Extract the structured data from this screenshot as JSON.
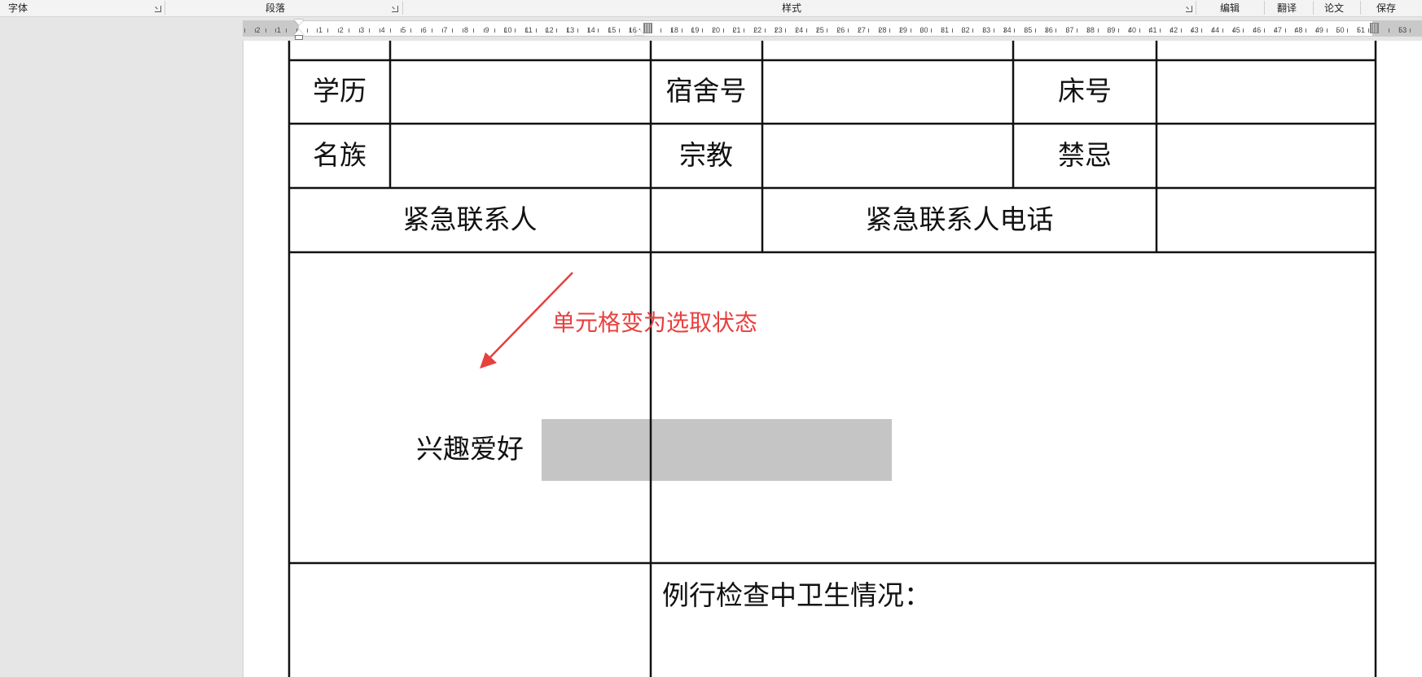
{
  "ribbon": {
    "groups": [
      "字体",
      "段落",
      "样式"
    ],
    "commands": [
      "编辑",
      "翻译",
      "论文",
      "保存"
    ]
  },
  "ruler": {
    "left_ticks": [
      "2",
      "1"
    ],
    "right_ticks": [
      "1",
      "2",
      "3",
      "4",
      "5",
      "6",
      "7",
      "8",
      "9",
      "10",
      "11",
      "12",
      "13",
      "14",
      "15",
      "16",
      "18",
      "19",
      "20",
      "21",
      "22",
      "23",
      "24",
      "25",
      "26",
      "27",
      "28",
      "29",
      "30",
      "31",
      "32",
      "33",
      "34",
      "35",
      "36",
      "37",
      "38",
      "39",
      "40",
      "41",
      "42",
      "43",
      "44",
      "45",
      "46",
      "47",
      "48",
      "49",
      "50",
      "51",
      "53"
    ]
  },
  "table": {
    "rows": [
      [
        "学历",
        "",
        "宿舍号",
        "",
        "床号",
        ""
      ],
      [
        "名族",
        "",
        "宗教",
        "",
        "禁忌",
        ""
      ],
      [
        "紧急联系人",
        "",
        "紧急联系人电话",
        ""
      ]
    ],
    "selected_cell_text": "兴趣爱好",
    "hygiene_label": "例行检查中卫生情况："
  },
  "annotation": {
    "text": "单元格变为选取状态",
    "color": "#e8403e"
  },
  "colors": {
    "selection": "#c5c5c5",
    "page": "#ffffff",
    "workspace": "#e6e6e6"
  }
}
